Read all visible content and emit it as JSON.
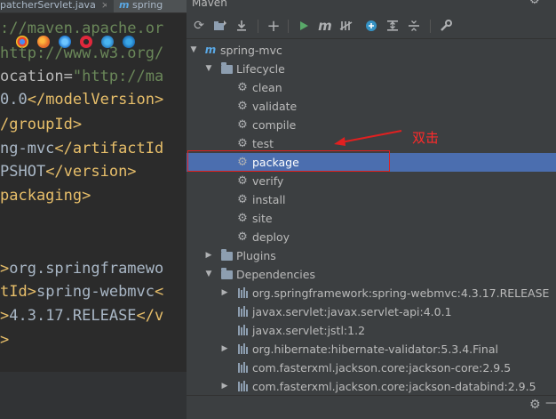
{
  "editor": {
    "tabs": [
      {
        "label": "patcherServlet.java",
        "close": "×"
      },
      {
        "label": "spring",
        "icon": "m"
      }
    ],
    "code": [
      {
        "text": "://maven.apache.or",
        "kind": "value"
      },
      {
        "text": "http://www.w3.org/",
        "kind": "value"
      },
      {
        "text": "ocation=\"http://ma",
        "kind": "attr"
      },
      {
        "text": "0.0</modelVersion>",
        "kind": "mixed1"
      },
      {
        "text": "/groupId>",
        "kind": "tag"
      },
      {
        "text": "ng-mvc</artifactId",
        "kind": "mixed2"
      },
      {
        "text": "PSHOT</version>",
        "kind": "mixed3"
      },
      {
        "text": "packaging>",
        "kind": "tag"
      },
      {
        "text": ">org.springframewo",
        "kind": "mixed4"
      },
      {
        "text": "tId>spring-webmvc<",
        "kind": "mixed5"
      },
      {
        "text": ">4.3.17.RELEASE</v",
        "kind": "mixed6"
      },
      {
        "text": ">",
        "kind": "tag"
      }
    ]
  },
  "maven": {
    "title": "Maven",
    "toolbar": {
      "reload": "reload-icon",
      "add_folder": "add-maven-project-icon",
      "download": "download-sources-icon",
      "add": "+",
      "run": "run-icon",
      "execute": "m",
      "toggle_offline": "toggle-offline-icon",
      "skip_tests": "skip-tests-icon",
      "show_dependencies": "show-dependencies-icon",
      "collapse": "collapse-all-icon",
      "settings": "wrench-icon"
    },
    "tree": {
      "project": "spring-mvc",
      "lifecycle": "Lifecycle",
      "phases": [
        "clean",
        "validate",
        "compile",
        "test",
        "package",
        "verify",
        "install",
        "site",
        "deploy"
      ],
      "selected_phase": "package",
      "plugins": "Plugins",
      "dependencies": "Dependencies",
      "deps": [
        {
          "label": "org.springframework:spring-webmvc:4.3.17.RELEASE",
          "expandable": true
        },
        {
          "label": "javax.servlet:javax.servlet-api:4.0.1",
          "expandable": false
        },
        {
          "label": "javax.servlet:jstl:1.2",
          "expandable": false
        },
        {
          "label": "org.hibernate:hibernate-validator:5.3.4.Final",
          "expandable": true
        },
        {
          "label": "com.fasterxml.jackson.core:jackson-core:2.9.5",
          "expandable": false
        },
        {
          "label": "com.fasterxml.jackson.core:jackson-databind:2.9.5",
          "expandable": true
        }
      ]
    }
  },
  "annotation": {
    "label": "双击",
    "color": "#e02020"
  }
}
